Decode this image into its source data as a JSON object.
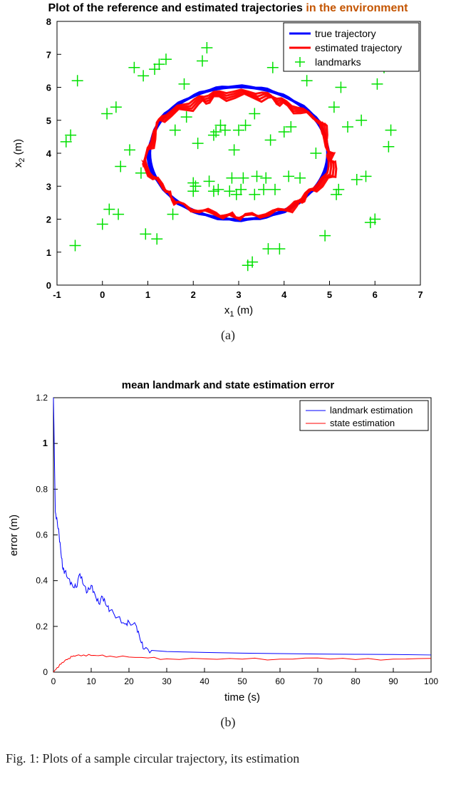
{
  "chart_data": [
    {
      "id": "a",
      "type": "scatter",
      "title": "Plot of the reference and estimated trajectories in the environment",
      "xlabel": "x_1 (m)",
      "ylabel": "x_2 (m)",
      "xlim": [
        -1,
        7
      ],
      "ylim": [
        0,
        8
      ],
      "xticks": [
        -1,
        0,
        1,
        2,
        3,
        4,
        5,
        6,
        7
      ],
      "yticks": [
        0,
        1,
        2,
        3,
        4,
        5,
        6,
        7,
        8
      ],
      "legend": {
        "position": "top-right",
        "entries": [
          {
            "label": "true trajectory",
            "color": "#0000ff",
            "style": "line",
            "width": 3
          },
          {
            "label": "estimated trajectory",
            "color": "#ff0000",
            "style": "line",
            "width": 3
          },
          {
            "label": "landmarks",
            "color": "#00e000",
            "style": "plus",
            "width": 1
          }
        ]
      },
      "series": [
        {
          "name": "true trajectory",
          "type": "ellipse",
          "cx": 3.0,
          "cy": 4.0,
          "rx": 1.95,
          "ry": 2.0,
          "color": "#0000ff"
        },
        {
          "name": "estimated trajectory",
          "type": "ellipse",
          "cx": 3.0,
          "cy": 3.95,
          "rx": 2.0,
          "ry": 1.9,
          "color": "#ff0000"
        },
        {
          "name": "landmarks",
          "type": "points",
          "color": "#00e000",
          "marker": "+",
          "points": [
            [
              -0.6,
              1.2
            ],
            [
              -0.8,
              4.35
            ],
            [
              -0.7,
              4.55
            ],
            [
              -0.55,
              6.2
            ],
            [
              0.0,
              1.85
            ],
            [
              0.1,
              5.2
            ],
            [
              0.3,
              5.4
            ],
            [
              0.35,
              2.15
            ],
            [
              0.15,
              2.3
            ],
            [
              0.6,
              4.1
            ],
            [
              0.7,
              6.6
            ],
            [
              0.9,
              6.35
            ],
            [
              0.85,
              3.4
            ],
            [
              0.95,
              1.55
            ],
            [
              1.2,
              1.4
            ],
            [
              1.25,
              6.7
            ],
            [
              1.4,
              6.85
            ],
            [
              1.55,
              2.15
            ],
            [
              1.6,
              4.7
            ],
            [
              1.8,
              6.1
            ],
            [
              1.85,
              5.1
            ],
            [
              2.0,
              2.85
            ],
            [
              2.05,
              3.0
            ],
            [
              2.1,
              4.3
            ],
            [
              2.2,
              6.8
            ],
            [
              2.3,
              7.2
            ],
            [
              2.35,
              3.15
            ],
            [
              2.45,
              2.85
            ],
            [
              2.5,
              4.65
            ],
            [
              2.55,
              2.9
            ],
            [
              2.6,
              4.85
            ],
            [
              2.7,
              4.7
            ],
            [
              2.8,
              2.85
            ],
            [
              2.85,
              3.25
            ],
            [
              2.9,
              4.1
            ],
            [
              2.95,
              2.75
            ],
            [
              3.0,
              4.7
            ],
            [
              3.05,
              2.9
            ],
            [
              3.1,
              3.25
            ],
            [
              3.15,
              4.85
            ],
            [
              3.2,
              0.6
            ],
            [
              3.3,
              0.7
            ],
            [
              3.35,
              2.75
            ],
            [
              3.4,
              3.3
            ],
            [
              3.55,
              2.9
            ],
            [
              3.6,
              3.25
            ],
            [
              3.65,
              1.1
            ],
            [
              3.7,
              4.4
            ],
            [
              3.75,
              6.6
            ],
            [
              3.8,
              2.9
            ],
            [
              3.9,
              1.1
            ],
            [
              4.0,
              4.65
            ],
            [
              4.1,
              3.3
            ],
            [
              4.15,
              4.8
            ],
            [
              4.2,
              6.7
            ],
            [
              4.35,
              3.25
            ],
            [
              4.5,
              6.2
            ],
            [
              4.7,
              4.0
            ],
            [
              4.9,
              1.5
            ],
            [
              5.1,
              5.4
            ],
            [
              5.15,
              2.75
            ],
            [
              5.2,
              2.9
            ],
            [
              5.25,
              6.0
            ],
            [
              5.4,
              4.8
            ],
            [
              5.6,
              3.2
            ],
            [
              5.7,
              5.0
            ],
            [
              5.8,
              3.3
            ],
            [
              5.9,
              1.9
            ],
            [
              6.0,
              2.0
            ],
            [
              6.05,
              6.1
            ],
            [
              6.2,
              6.6
            ],
            [
              6.3,
              4.2
            ],
            [
              6.35,
              4.7
            ],
            [
              1.15,
              6.55
            ],
            [
              0.4,
              3.6
            ],
            [
              2.45,
              4.55
            ],
            [
              3.35,
              5.2
            ],
            [
              2.0,
              3.1
            ]
          ]
        }
      ]
    },
    {
      "id": "b",
      "type": "line",
      "title": "mean landmark and state estimation error",
      "xlabel": "time (s)",
      "ylabel": "error (m)",
      "xlim": [
        0,
        100
      ],
      "ylim": [
        0,
        1.2
      ],
      "xticks": [
        0,
        10,
        20,
        30,
        40,
        50,
        60,
        70,
        80,
        90,
        100
      ],
      "yticks": [
        0,
        0.2,
        0.4,
        0.6,
        0.8,
        1,
        1.2
      ],
      "legend": {
        "position": "top-right",
        "entries": [
          {
            "label": "landmark estimation",
            "color": "#0000ff",
            "style": "line",
            "width": 1
          },
          {
            "label": "state estimation",
            "color": "#ff0000",
            "style": "line",
            "width": 1
          }
        ]
      },
      "series": [
        {
          "name": "landmark estimation",
          "color": "#0000ff",
          "x": [
            0,
            0.5,
            1,
            1.5,
            2,
            2.5,
            3,
            4,
            5,
            6,
            7,
            8,
            9,
            10,
            11,
            12,
            13,
            14,
            15,
            17,
            19,
            20,
            22,
            23,
            24,
            26,
            30,
            35,
            40,
            50,
            60,
            70,
            80,
            90,
            100
          ],
          "y": [
            1.2,
            0.7,
            0.66,
            0.6,
            0.52,
            0.45,
            0.44,
            0.41,
            0.38,
            0.37,
            0.43,
            0.38,
            0.35,
            0.38,
            0.34,
            0.3,
            0.33,
            0.29,
            0.27,
            0.24,
            0.21,
            0.22,
            0.2,
            0.14,
            0.1,
            0.095,
            0.09,
            0.088,
            0.086,
            0.083,
            0.081,
            0.079,
            0.078,
            0.077,
            0.075
          ]
        },
        {
          "name": "state estimation",
          "color": "#ff0000",
          "x": [
            0,
            1,
            2,
            3,
            4,
            5,
            6,
            8,
            10,
            12,
            15,
            20,
            25,
            30,
            40,
            50,
            60,
            70,
            80,
            90,
            100
          ],
          "y": [
            0.0,
            0.02,
            0.035,
            0.05,
            0.06,
            0.068,
            0.072,
            0.075,
            0.073,
            0.072,
            0.07,
            0.066,
            0.062,
            0.058,
            0.058,
            0.057,
            0.057,
            0.062,
            0.055,
            0.057,
            0.06
          ]
        }
      ]
    }
  ],
  "subcaptions": {
    "a": "(a)",
    "b": "(b)"
  },
  "caption_prefix": "Fig. 1: Plots of a sample circular trajectory, its estimation"
}
